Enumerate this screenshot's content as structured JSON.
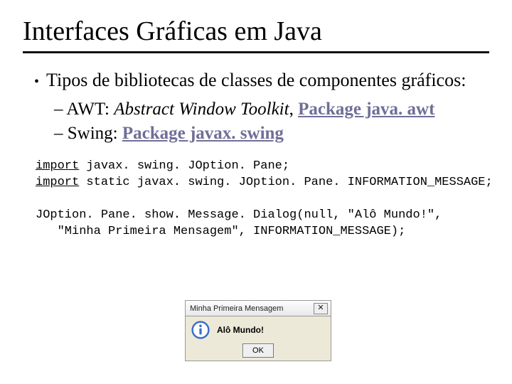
{
  "title": "Interfaces Gráficas em Java",
  "bullet": {
    "main": "Tipos de bibliotecas de classes de componentes gráficos:",
    "sub1_prefix": "– AWT: ",
    "sub1_italic": "Abstract Window Toolkit",
    "sub1_sep": ", ",
    "sub1_link": "Package java. awt",
    "sub2_prefix": "– Swing: ",
    "sub2_link": "Package javax. swing"
  },
  "code": {
    "kw_import": "import",
    "line1_rest": " javax. swing. JOption. Pane;",
    "line2_rest": " static javax. swing. JOption. Pane. INFORMATION_MESSAGE;",
    "line3": "JOption. Pane. show. Message. Dialog(null, \"Alô Mundo!\",",
    "line4": "   \"Minha Primeira Mensagem\", INFORMATION_MESSAGE);"
  },
  "dialog": {
    "title": "Minha Primeira Mensagem",
    "message": "Alô Mundo!",
    "ok": "OK",
    "close": "✕"
  }
}
